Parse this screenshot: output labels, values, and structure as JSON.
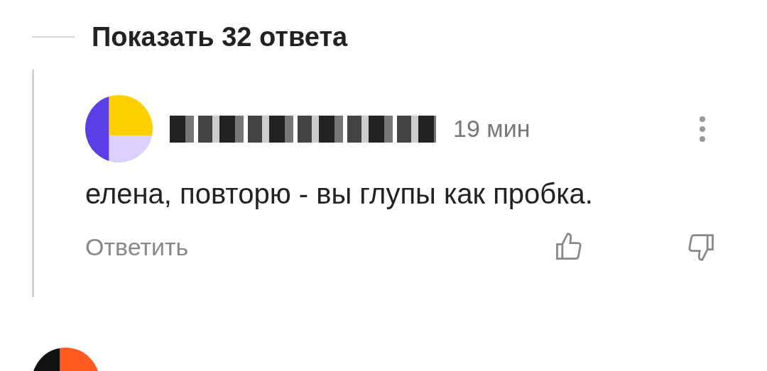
{
  "replies_toggle": {
    "label": "Показать 32 ответа"
  },
  "comment": {
    "time": "19 мин",
    "text": "елена, повторю - вы глупы как пробка.",
    "reply_button": "Ответить"
  }
}
